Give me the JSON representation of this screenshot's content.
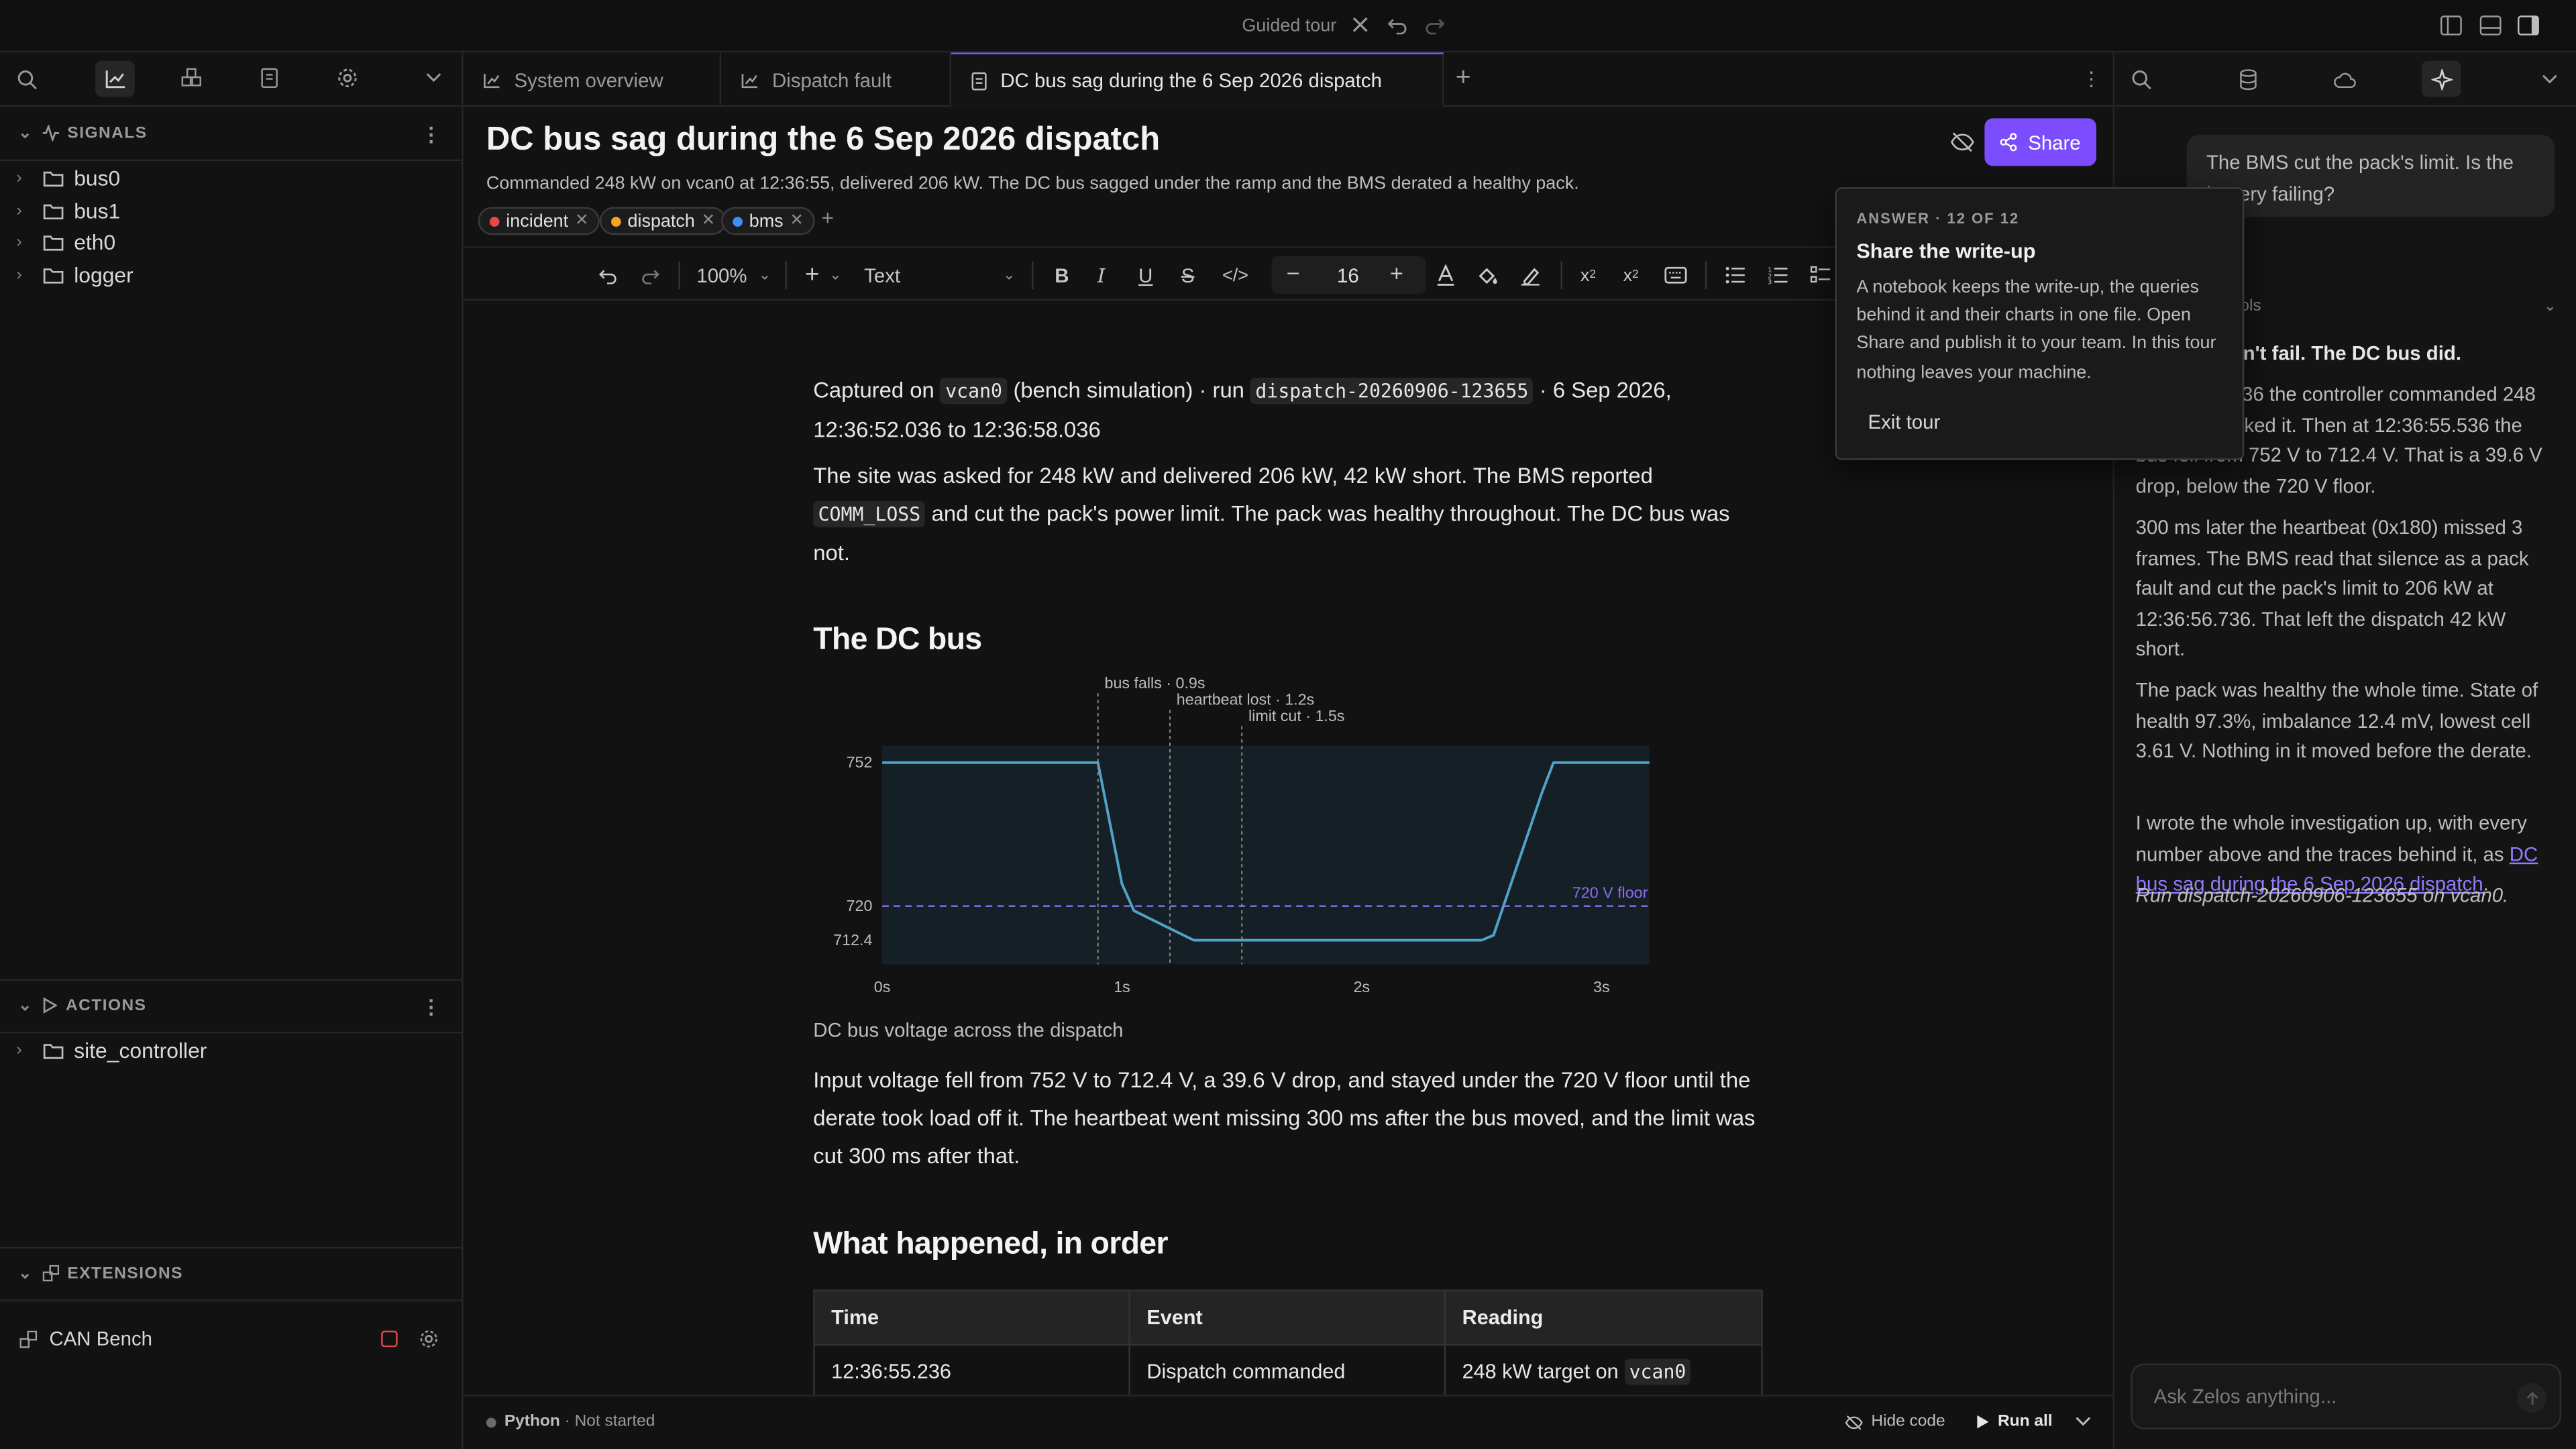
{
  "titlebar": {
    "tour_label": "Guided tour"
  },
  "sidebar": {
    "signals_label": "SIGNALS",
    "signals": [
      "bus0",
      "bus1",
      "eth0",
      "logger"
    ],
    "actions_label": "ACTIONS",
    "actions": [
      "site_controller"
    ],
    "extensions_label": "EXTENSIONS",
    "extension_name": "CAN Bench"
  },
  "tabs": [
    {
      "label": "System overview"
    },
    {
      "label": "Dispatch fault"
    },
    {
      "label": "DC bus sag during the 6 Sep 2026 dispatch"
    }
  ],
  "doc": {
    "title": "DC bus sag during the 6 Sep 2026 dispatch",
    "subtitle": "Commanded 248 kW on vcan0 at 12:36:55, delivered 206 kW. The DC bus sagged under the ramp and the BMS derated a healthy pack.",
    "tags": [
      {
        "label": "incident",
        "color": "#e5484d"
      },
      {
        "label": "dispatch",
        "color": "#f5a524"
      },
      {
        "label": "bms",
        "color": "#3e8ef7"
      }
    ],
    "share_label": "Share",
    "p1": {
      "a": "Captured on ",
      "code1": "vcan0",
      "b": " (bench simulation) · run ",
      "code2": "dispatch-20260906-123655",
      "c": " · 6 Sep 2026, 12:36:52.036 to 12:36:58.036"
    },
    "p2": {
      "a": "The site was asked for 248 kW and delivered 206 kW, 42 kW short. The BMS reported ",
      "code": "COMM_LOSS",
      "b": " and cut the pack's power limit. The pack was healthy throughout. The DC bus was not."
    },
    "h_dcbus": "The DC bus",
    "caption": "DC bus voltage across the dispatch",
    "p3": "Input voltage fell from 752 V to 712.4 V, a 39.6 V drop, and stayed under the 720 V floor until the derate took load off it. The heartbeat went missing 300 ms after the bus moved, and the limit was cut 300 ms after that.",
    "h_order": "What happened, in order",
    "table": {
      "headers": [
        "Time",
        "Event",
        "Reading"
      ],
      "rows": [
        {
          "time": "12:36:55.236",
          "event": "Dispatch commanded",
          "reading_a": "248 kW target on ",
          "reading_code": "vcan0"
        }
      ]
    }
  },
  "toolbar": {
    "zoom": "100%",
    "style": "Text",
    "font_size": "16"
  },
  "statusbar": {
    "kernel": "Python",
    "kernel_state": " · Not started",
    "hide_code": "Hide code",
    "run_all": "Run all"
  },
  "tour": {
    "kicker": "ANSWER · 12 OF 12",
    "title": "Share the write-up",
    "body": "A notebook keeps the write-up, the queries behind it and their charts in one file. Open Share and publish it to your team. In this tour nothing leaves your machine.",
    "exit": "Exit tour"
  },
  "rpanel": {
    "user_msg": "The BMS cut the pack's limit. Is the battery failing?",
    "tools_label": "ools",
    "lead": "dn't fail. The DC bus did.",
    "p1": "236 the controller commanded 248 d power tracked it. Then at 12:36:55.536 the bus fell from 752 V to 712.4 V. That is a 39.6 V drop, below the 720 V floor.",
    "p2": "300 ms later the heartbeat (0x180) missed 3 frames. The BMS read that silence as a pack fault and cut the pack's limit to 206 kW at 12:36:56.736. That left the dispatch 42 kW short.",
    "p3": "The pack was healthy the whole time. State of health 97.3%, imbalance 12.4 mV, lowest cell 3.61 V. Nothing in it moved before the derate.",
    "p4_a": "I wrote the whole investigation up, with every number above and the traces behind it, as ",
    "p4_link": "DC bus sag during the 6 Sep 2026 dispatch",
    "p4_b": ".",
    "p5": "Run dispatch-20260906-123655 on vcan0.",
    "ask_placeholder": "Ask Zelos anything..."
  },
  "chart_data": {
    "type": "line",
    "title": "",
    "xlabel": "",
    "ylabel": "",
    "x_ticks": [
      "0s",
      "1s",
      "2s",
      "3s"
    ],
    "y_ticks": [
      752,
      720,
      712.4
    ],
    "xlim": [
      0,
      3.2
    ],
    "ylim": [
      707,
      755
    ],
    "series": [
      {
        "x": [
          0,
          0.9,
          1.0,
          1.05,
          1.2,
          1.3,
          2.5,
          2.55,
          2.75,
          2.8,
          3.2
        ],
        "y": [
          752,
          752,
          725,
          719,
          715,
          712.4,
          712.4,
          713.5,
          745,
          752,
          752
        ]
      }
    ],
    "threshold": {
      "value": 720,
      "label": "720 V floor"
    },
    "annotations": [
      {
        "x": 0.9,
        "label": "bus falls · 0.9s"
      },
      {
        "x": 1.2,
        "label": "heartbeat lost · 1.2s"
      },
      {
        "x": 1.5,
        "label": "limit cut · 1.5s"
      }
    ],
    "colors": {
      "line": "#4fa3c7",
      "fill": "#152026",
      "threshold": "#8b6cf0"
    }
  }
}
